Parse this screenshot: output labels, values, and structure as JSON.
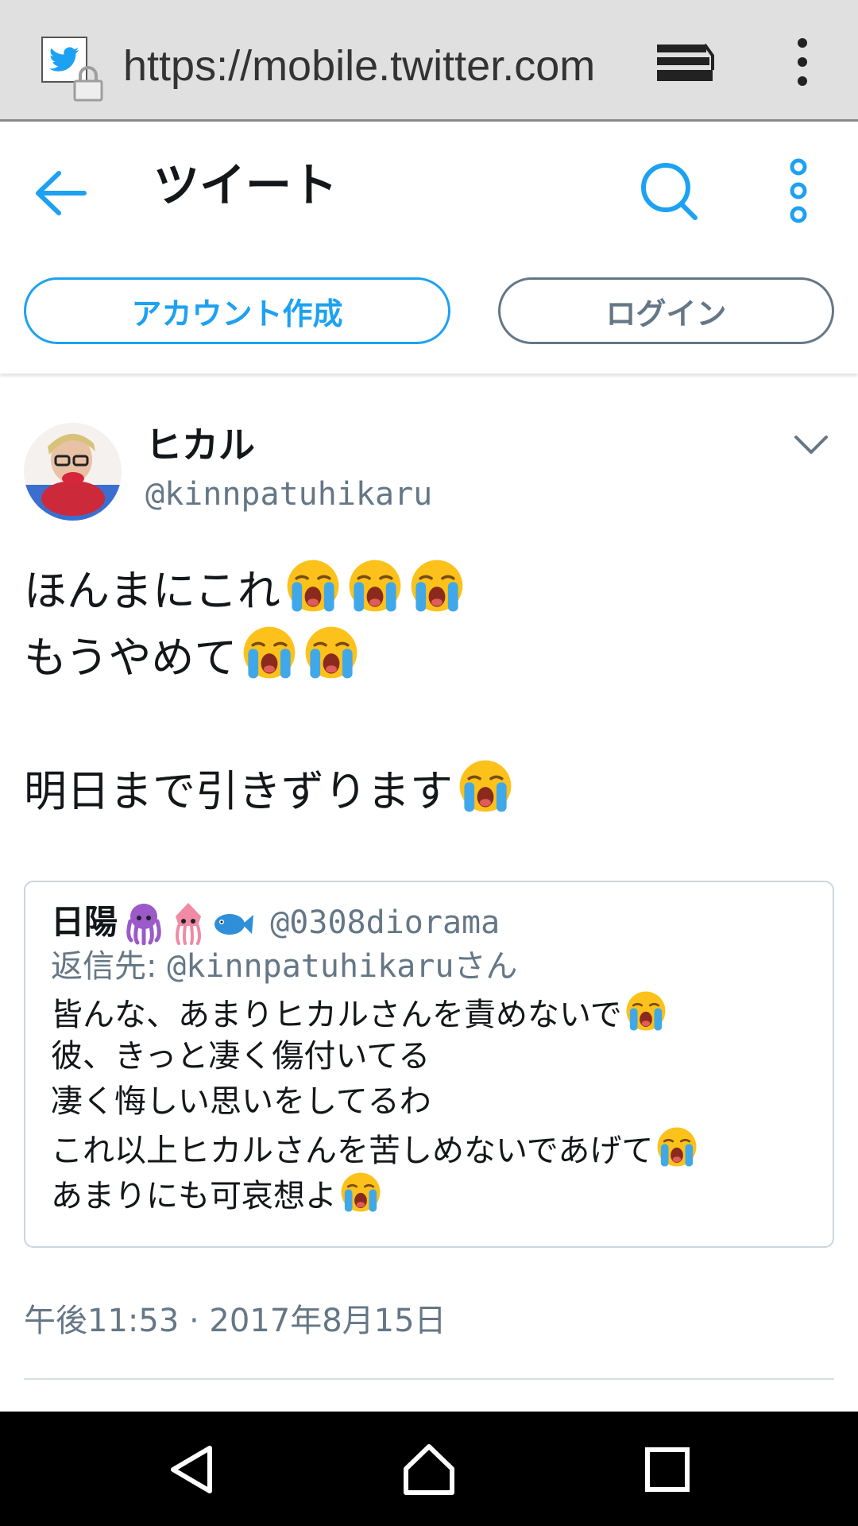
{
  "browser": {
    "url": "https://mobile.twitter.com"
  },
  "header": {
    "title": "ツイート",
    "signup_label": "アカウント作成",
    "login_label": "ログイン"
  },
  "tweet": {
    "name": "ヒカル",
    "handle": "@kinnpatuhikaru",
    "lines": [
      "ほんまにこれ",
      "もうやめて",
      "",
      "明日まで引きずります"
    ],
    "line_emoji_counts": [
      3,
      2,
      0,
      1
    ],
    "timestamp": "午後11:53 · 2017年8月15日"
  },
  "quote": {
    "name": "日陽",
    "name_emoji": [
      "octopus",
      "squid",
      "fish"
    ],
    "handle": "@0308diorama",
    "reply_prefix": "返信先: ",
    "reply_handle": "@kinnpatuhikaru",
    "reply_suffix": "さん",
    "lines": [
      "皆んな、あまりヒカルさんを責めないで",
      "彼、きっと凄く傷付いてる",
      "凄く悔しい思いをしてるわ",
      "これ以上ヒカルさんを苦しめないであげて",
      "あまりにも可哀想よ"
    ],
    "line_emoji_counts": [
      1,
      0,
      0,
      1,
      1
    ]
  },
  "colors": {
    "accent": "#1da1f2",
    "secondary": "#657786",
    "nav_bg": "#000000",
    "browser_bg": "#e0e0e0"
  },
  "icons": {
    "emoji": "loudly-crying-face"
  }
}
